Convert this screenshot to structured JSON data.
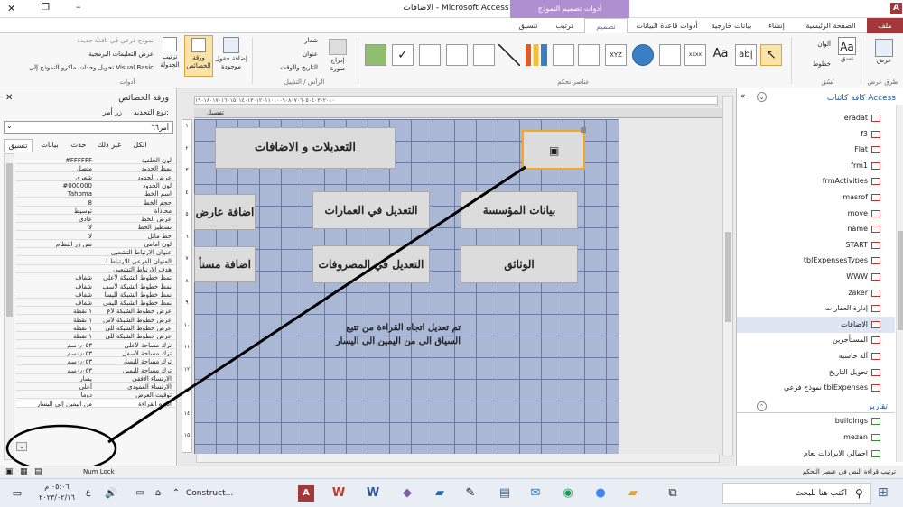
{
  "window": {
    "title": "الاضافات - Microsoft Access",
    "context_tab": "أدوات تصميم النموذج",
    "app_letter": "A"
  },
  "tabs": {
    "file": "ملف",
    "home": "الصفحة الرئيسية",
    "create": "إنشاء",
    "external": "بيانات خارجية",
    "dbtools": "أدوات قاعدة البيانات",
    "design": "تصميم",
    "arrange": "ترتيب",
    "format": "تنسيق"
  },
  "ribbon": {
    "views_label": "عرض",
    "views_group": "طرق عرض",
    "themes_label": "نسق",
    "colors_label": "ألوان",
    "fonts_label": "خطوط",
    "themes_group": "نُسُق",
    "controls_group": "عناصر تحكم",
    "insert_image": "إدراج صورة",
    "logo_label": "شعار",
    "title_label": "عنوان",
    "datetime_label": "التاريخ والوقت",
    "header_group": "الرأس / التذييل",
    "add_fields": "إضافة حقول موجودة",
    "property_sheet": "ورقة الخصائص",
    "tab_order": "ترتيب الجدولة",
    "subform_new_window": "نموذج فرعي في نافذة جديدة",
    "view_code": "عرض التعليمات البرمجية",
    "convert_macros": "تحويل وحدات ماكرو النموذج إلى Visual Basic",
    "tools_group": "أدوات"
  },
  "property_sheet": {
    "title": "ورقة الخصائص",
    "selection_type_label": "نوع التحديد:",
    "selection_type_value": "زر أمر",
    "selected_control": "أمر٦٦",
    "tabs": [
      "تنسيق",
      "بيانات",
      "حدث",
      "غير ذلك",
      "الكل"
    ],
    "rows": [
      {
        "name": "لون الخلفية",
        "value": "#FFFFFF"
      },
      {
        "name": "نمط الحدود",
        "value": "متصل"
      },
      {
        "name": "عرض الحدود",
        "value": "شعري"
      },
      {
        "name": "لون الحدود",
        "value": "#000000"
      },
      {
        "name": "اسم الخط",
        "value": "Tahoma"
      },
      {
        "name": "حجم الخط",
        "value": "8"
      },
      {
        "name": "محاذاة",
        "value": "توسيط"
      },
      {
        "name": "عرض الخط",
        "value": "عادي"
      },
      {
        "name": "تسطير الخط",
        "value": "لا"
      },
      {
        "name": "خط مائل",
        "value": "لا"
      },
      {
        "name": "لون أمامي",
        "value": "نص زر النظام"
      },
      {
        "name": "عنوان الارتباط التشعبي",
        "value": ""
      },
      {
        "name": "العنوان الفرعي للارتباط ا",
        "value": ""
      },
      {
        "name": "هدف الارتباط التشعبي",
        "value": ""
      },
      {
        "name": "نمط خطوط الشبكة لأعلى",
        "value": "شفاف"
      },
      {
        "name": "نمط خطوط الشبكة لأسف",
        "value": "شفاف"
      },
      {
        "name": "نمط خطوط الشبكة لليسا",
        "value": "شفاف"
      },
      {
        "name": "نمط خطوط الشبكة لليمي",
        "value": "شفاف"
      },
      {
        "name": "عرض خطوط الشبكة لأع",
        "value": "١ نقطة"
      },
      {
        "name": "عرض خطوط الشبكة لأس",
        "value": "١ نقطة"
      },
      {
        "name": "عرض خطوط الشبكة للي",
        "value": "١ نقطة"
      },
      {
        "name": "عرض خطوط الشبكة للي",
        "value": "١ نقطة"
      },
      {
        "name": "ترك مساحة لأعلى",
        "value": "٠٫٠٥٣سم"
      },
      {
        "name": "ترك مساحة لأسفل",
        "value": "٠٫٠٥٣سم"
      },
      {
        "name": "ترك مساحة لليسار",
        "value": "٠٫٠٥٣سم"
      },
      {
        "name": "ترك مساحة لليمين",
        "value": "٠٫٠٥٣سم"
      },
      {
        "name": "الارتساء الأفقي",
        "value": "يسار"
      },
      {
        "name": "الارتساء العمودي",
        "value": "أعلى"
      },
      {
        "name": "توقيت العرض",
        "value": "دوماً"
      },
      {
        "name": "اتجاه القراءة",
        "value": "من اليمين إلى اليسار"
      }
    ]
  },
  "form": {
    "section": "تفصيل",
    "title_label": "التعديلات و الاضافات",
    "buttons": [
      "اضافة عارض",
      "التعديل في العمارات",
      "بيانات المؤسسة",
      "اضافة مستأ",
      "التعديل في المصروفات",
      "الوثائق"
    ],
    "note": "تم تعديل اتجاه القراءة من تتبع السياق الى من اليمين الى اليسار",
    "ruler_marks": "١٩٠١٨٠١٧٠١٦٠١٥٠١٤٠١٣٠١٢٠١١٠١٠٠٩٠٨٠٧٠٦٠٥٠٤٠٣٠٢٠١٠",
    "row_numbers": [
      "١",
      "٢",
      "٣",
      "٤",
      "٥",
      "٦",
      "٧",
      "٨",
      "٩",
      "١٠",
      "١١",
      "١٢",
      "١٣",
      "١٤",
      "١٥"
    ]
  },
  "nav": {
    "title": "كافة كائنات Access",
    "items": [
      "eradat",
      "f3",
      "Flat",
      "frm1",
      "frmActivities",
      "masrof",
      "move",
      "name",
      "START",
      "tblExpensesTypes",
      "WWW",
      "zaker",
      "إدارة العقارات",
      "الاضافات",
      "المستأجرين",
      "آلة حاسبة",
      "تحويل التاريخ",
      "نموذج فرعي tblExpenses"
    ],
    "reports_header": "تقارير",
    "reports": [
      "buildings",
      "mezan",
      "اجمالي الايرادات لعام"
    ]
  },
  "status": {
    "left_text": "ترتيب قراءة النص في عنصر التحكم",
    "numlock": "Num Lock"
  },
  "taskbar": {
    "search": "اكتب هنا للبحث",
    "time": "٠٥:٠٦ م",
    "date": "٢٠٢٣/٠٢/١٦",
    "lang": "ع",
    "task_label": "Construct..."
  },
  "colors": {
    "access_red": "#a4373a",
    "context_purple": "#7f5ea8",
    "grid_blue": "#aab8d6",
    "selection_orange": "#f5a623"
  }
}
